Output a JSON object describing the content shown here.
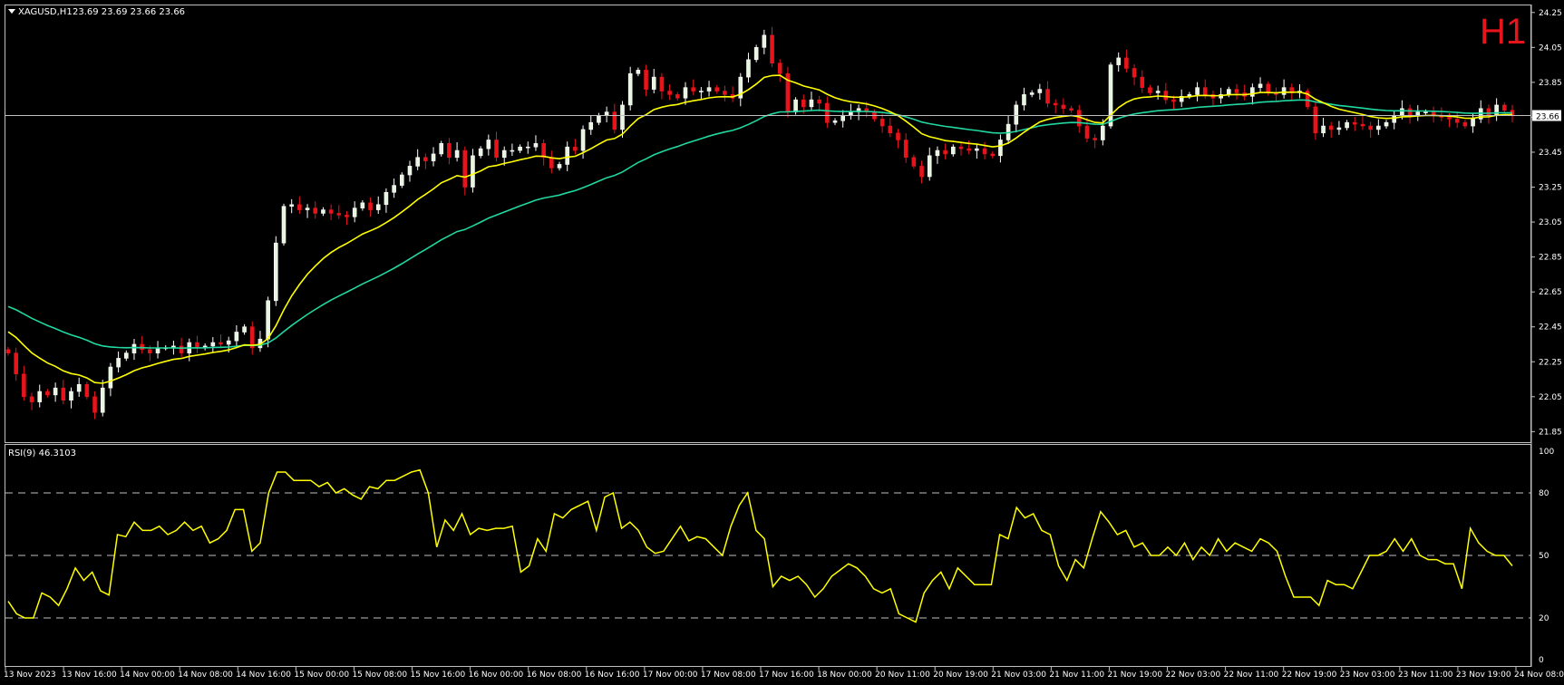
{
  "header": {
    "symbol": "XAGUSD,H1",
    "ohlc": "23.69 23.69 23.66 23.66",
    "timeframe": "H1"
  },
  "rsi": {
    "label": "RSI(9) 46.3103",
    "levels": [
      80,
      50,
      20
    ],
    "scale_labels": [
      "100",
      "80",
      "50",
      "20",
      "0"
    ]
  },
  "colors": {
    "background": "#000000",
    "frame": "#c0c0c0",
    "bull": "#ffffff",
    "bull_fill": "#e8f5e0",
    "bear": "#e8141b",
    "ma_fast": "#ffff00",
    "ma_slow": "#20d8a0",
    "rsi_line": "#ffff00",
    "text": "#ffffff"
  },
  "chart_data": {
    "type": "candlestick",
    "instrument": "XAGUSD",
    "timeframe": "H1",
    "last_price": "23.66",
    "ylim": [
      21.8,
      24.28
    ],
    "y_ticks": [
      "24.25",
      "24.05",
      "23.85",
      "23.65",
      "23.45",
      "23.25",
      "23.05",
      "22.85",
      "22.65",
      "22.45",
      "22.25",
      "22.05",
      "21.85"
    ],
    "x_ticks": [
      "13 Nov 2023",
      "13 Nov 16:00",
      "14 Nov 00:00",
      "14 Nov 08:00",
      "14 Nov 16:00",
      "15 Nov 00:00",
      "15 Nov 08:00",
      "15 Nov 16:00",
      "16 Nov 00:00",
      "16 Nov 08:00",
      "16 Nov 16:00",
      "17 Nov 00:00",
      "17 Nov 08:00",
      "17 Nov 16:00",
      "18 Nov 00:00",
      "20 Nov 11:00",
      "20 Nov 19:00",
      "21 Nov 03:00",
      "21 Nov 11:00",
      "21 Nov 19:00",
      "22 Nov 03:00",
      "22 Nov 11:00",
      "22 Nov 19:00",
      "23 Nov 03:00",
      "23 Nov 11:00",
      "23 Nov 19:00",
      "24 Nov 08:00"
    ],
    "close_path": [
      22.3,
      22.18,
      22.05,
      22.02,
      22.08,
      22.06,
      22.1,
      22.03,
      22.08,
      22.12,
      22.05,
      21.96,
      22.1,
      22.22,
      22.27,
      22.3,
      22.35,
      22.32,
      22.3,
      22.33,
      22.33,
      22.34,
      22.3,
      22.36,
      22.33,
      22.34,
      22.36,
      22.35,
      22.37,
      22.42,
      22.45,
      22.33,
      22.38,
      22.6,
      22.93,
      23.14,
      23.15,
      23.12,
      23.13,
      23.1,
      23.12,
      23.1,
      23.09,
      23.08,
      23.13,
      23.16,
      23.12,
      23.15,
      23.22,
      23.26,
      23.32,
      23.37,
      23.42,
      23.4,
      23.44,
      23.5,
      23.42,
      23.46,
      23.25,
      23.43,
      23.47,
      23.52,
      23.42,
      23.46,
      23.46,
      23.48,
      23.48,
      23.5,
      23.42,
      23.36,
      23.38,
      23.48,
      23.46,
      23.58,
      23.62,
      23.66,
      23.68,
      23.58,
      23.72,
      23.9,
      23.92,
      23.81,
      23.88,
      23.8,
      23.78,
      23.76,
      23.82,
      23.8,
      23.8,
      23.82,
      23.8,
      23.78,
      23.76,
      23.88,
      23.98,
      24.05,
      24.12,
      23.96,
      23.9,
      23.68,
      23.75,
      23.71,
      23.75,
      23.73,
      23.62,
      23.63,
      23.66,
      23.68,
      23.7,
      23.68,
      23.64,
      23.6,
      23.56,
      23.52,
      23.42,
      23.37,
      23.31,
      23.43,
      23.46,
      23.44,
      23.48,
      23.47,
      23.46,
      23.47,
      23.44,
      23.43,
      23.52,
      23.61,
      23.72,
      23.78,
      23.79,
      23.81,
      23.73,
      23.72,
      23.7,
      23.69,
      23.6,
      23.53,
      23.52,
      23.6,
      23.95,
      23.99,
      23.93,
      23.88,
      23.82,
      23.79,
      23.8,
      23.75,
      23.74,
      23.77,
      23.78,
      23.82,
      23.78,
      23.76,
      23.78,
      23.81,
      23.79,
      23.77,
      23.82,
      23.84,
      23.79,
      23.78,
      23.82,
      23.79,
      23.8,
      23.71,
      23.56,
      23.6,
      23.58,
      23.59,
      23.62,
      23.61,
      23.6,
      23.58,
      23.6,
      23.62,
      23.66,
      23.7,
      23.66,
      23.68,
      23.68,
      23.66,
      23.65,
      23.64,
      23.62,
      23.6,
      23.64,
      23.7,
      23.66,
      23.72,
      23.69,
      23.66
    ],
    "rsi_values": [
      28,
      22,
      20,
      20,
      32,
      30,
      26,
      34,
      44,
      38,
      42,
      33,
      31,
      60,
      59,
      66,
      62,
      62,
      64,
      60,
      62,
      66,
      62,
      64,
      56,
      58,
      62,
      72,
      72,
      52,
      56,
      80,
      90,
      90,
      86,
      86,
      86,
      83,
      85,
      80,
      82,
      79,
      77,
      83,
      82,
      86,
      86,
      88,
      90,
      91,
      80,
      54,
      67,
      62,
      70,
      60,
      63,
      62,
      63,
      63,
      64,
      42,
      45,
      58,
      52,
      70,
      68,
      72,
      74,
      76,
      62,
      78,
      80,
      63,
      66,
      62,
      54,
      51,
      52,
      58,
      64,
      57,
      59,
      58,
      54,
      50,
      64,
      74,
      80,
      62,
      58,
      35,
      40,
      38,
      40,
      36,
      30,
      34,
      40,
      43,
      46,
      44,
      40,
      34,
      32,
      34,
      22,
      20,
      18,
      32,
      38,
      42,
      34,
      44,
      40,
      36,
      36,
      36,
      60,
      58,
      73,
      68,
      70,
      62,
      60,
      45,
      38,
      48,
      44,
      58,
      71,
      66,
      60,
      62,
      54,
      56,
      50,
      50,
      54,
      50,
      56,
      48,
      54,
      50,
      58,
      52,
      56,
      54,
      52,
      58,
      56,
      52,
      40,
      30,
      30,
      30,
      26,
      38,
      36,
      36,
      34,
      42,
      50,
      50,
      52,
      58,
      52,
      58,
      50,
      48,
      48,
      46,
      46,
      34,
      63,
      56,
      52,
      50,
      50,
      45
    ]
  }
}
